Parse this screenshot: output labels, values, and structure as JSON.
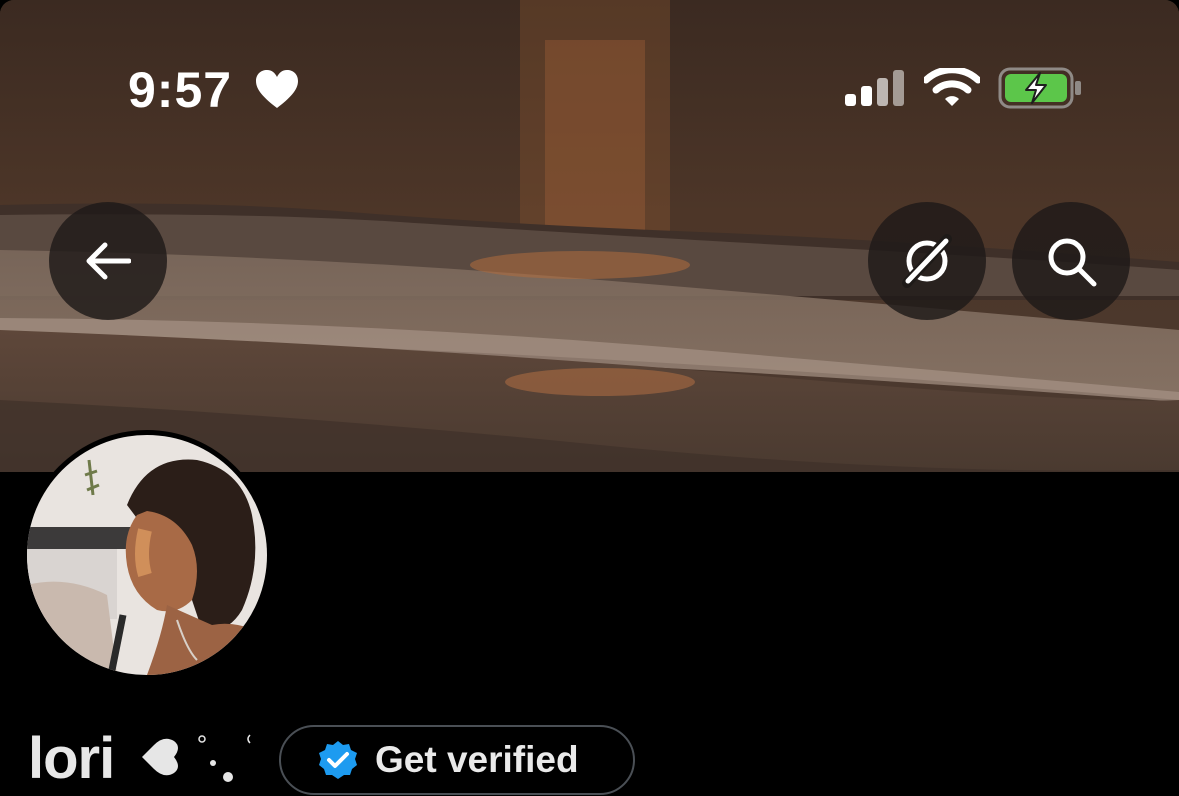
{
  "status_bar": {
    "time": "9:57",
    "icons": [
      "heart-icon",
      "signal-icon",
      "wifi-icon",
      "battery-charging-icon"
    ],
    "battery_color": "#5cc64a"
  },
  "header": {
    "buttons": [
      "back-arrow-icon",
      "no-network-icon",
      "search-icon"
    ]
  },
  "profile": {
    "display_name": "lori",
    "name_decoration": "heart-sparkle-emoji",
    "verify_button_label": "Get verified",
    "verify_badge_color": "#1d9bf0"
  }
}
